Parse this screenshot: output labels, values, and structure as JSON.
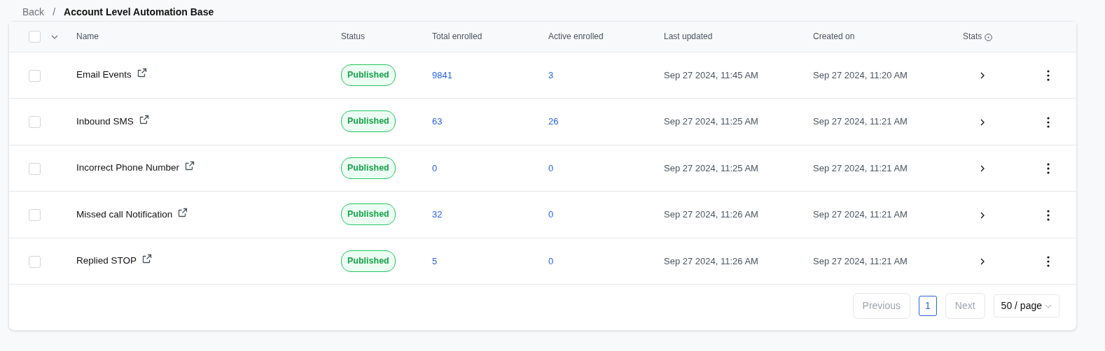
{
  "breadcrumb": {
    "back": "Back",
    "separator": "/",
    "current": "Account Level Automation Base"
  },
  "table": {
    "select_all_checked": false,
    "columns": [
      "Name",
      "Status",
      "Total enrolled",
      "Active enrolled",
      "Last updated",
      "Created on",
      "Stats"
    ],
    "rows": [
      {
        "checked": false,
        "name": "Email Events",
        "status": "Published",
        "total": "9841",
        "active": "3",
        "last_updated": "Sep 27 2024, 11:45 AM",
        "created_on": "Sep 27 2024, 11:20 AM"
      },
      {
        "checked": false,
        "name": "Inbound SMS",
        "status": "Published",
        "total": "63",
        "active": "26",
        "last_updated": "Sep 27 2024, 11:25 AM",
        "created_on": "Sep 27 2024, 11:21 AM"
      },
      {
        "checked": false,
        "name": "Incorrect Phone Number",
        "status": "Published",
        "total": "0",
        "active": "0",
        "last_updated": "Sep 27 2024, 11:25 AM",
        "created_on": "Sep 27 2024, 11:21 AM"
      },
      {
        "checked": false,
        "name": "Missed call Notification",
        "status": "Published",
        "total": "32",
        "active": "0",
        "last_updated": "Sep 27 2024, 11:26 AM",
        "created_on": "Sep 27 2024, 11:21 AM"
      },
      {
        "checked": false,
        "name": "Replied STOP",
        "status": "Published",
        "total": "5",
        "active": "0",
        "last_updated": "Sep 27 2024, 11:26 AM",
        "created_on": "Sep 27 2024, 11:21 AM"
      }
    ]
  },
  "pagination": {
    "previous": {
      "label": "Previous",
      "disabled": true
    },
    "pages": [
      {
        "label": "1",
        "selected": true
      }
    ],
    "next": {
      "label": "Next",
      "disabled": true
    },
    "page_size": "50 / page"
  }
}
